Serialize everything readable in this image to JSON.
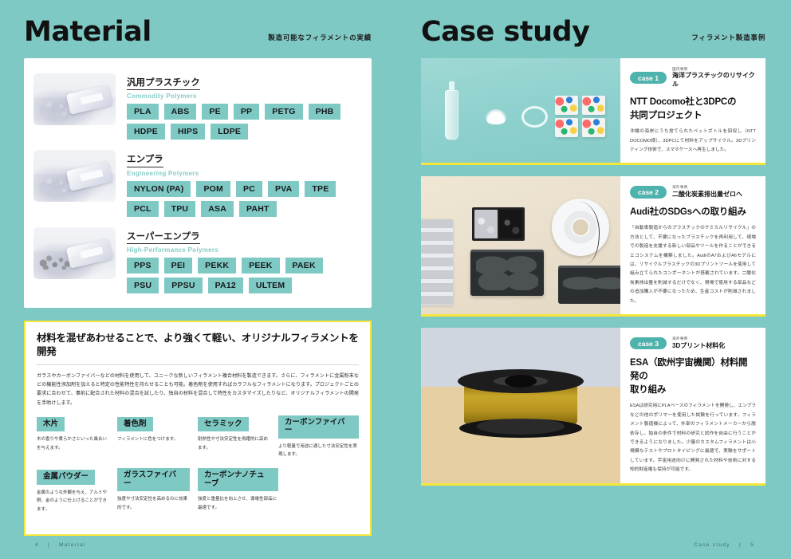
{
  "theme": {
    "background_teal": "#7fc9c4",
    "accent_yellow": "#f5e63c",
    "badge_teal": "#4fb3ad",
    "card_white": "#ffffff"
  },
  "left_page": {
    "title": "Material",
    "subtitle": "製造可能なフィラメントの実績",
    "footer": {
      "page_number": "4",
      "separator": "|",
      "section": "Material"
    },
    "material_groups": [
      {
        "name_ja": "汎用プラスチック",
        "name_en": "Commodity Polymers",
        "photo_alt": "plastic-pellets-bag-1",
        "chips": [
          "PLA",
          "ABS",
          "PE",
          "PP",
          "PETG",
          "PHB",
          "HDPE",
          "HIPS",
          "LDPE"
        ]
      },
      {
        "name_ja": "エンプラ",
        "name_en": "Engineering Polymers",
        "photo_alt": "plastic-pellets-bag-2",
        "chips": [
          "NYLON (PA)",
          "POM",
          "PC",
          "PVA",
          "TPE",
          "PCL",
          "TPU",
          "ASA",
          "PAHT"
        ]
      },
      {
        "name_ja": "スーパーエンプラ",
        "name_en": "High-Performance Polymers",
        "photo_alt": "plastic-pellets-bag-3",
        "chips": [
          "PPS",
          "PEI",
          "PEKK",
          "PEEK",
          "PAEK",
          "PSU",
          "PPSU",
          "PA12",
          "ULTEM"
        ]
      }
    ],
    "mix_section": {
      "title": "材料を混ぜあわせることで、より強くて軽い、オリジナルフィラメントを開発",
      "body": "ガラスやカーボンファイバーなどの材料を使用して、ユニークな新しいフィラメント複合材料を製造できます。さらに、フィラメントに金属粉末などの機能性添加剤を加えると特定の性能特性を持たせることも可能。着色剤を使用すればカラフルなフィラメントになります。プロジェクトごとの要求に合わせて、事前に配合された材料の混合を試したり、独自の材料を混合して特性をカスタマイズしたりなど、オリジナルフィラメントの開発を手助けします。",
      "additives": [
        {
          "tag": "木片",
          "desc": "木の香りや柔らかさといった風合いを与えます。"
        },
        {
          "tag": "着色剤",
          "desc": "フィラメントに色をつけます。"
        },
        {
          "tag": "セラミック",
          "desc": "耐熱性や寸法安定性を飛躍的に高めます。"
        },
        {
          "tag": "カーボンファイバー",
          "desc": "より軽量で用途に適した寸法安定性を実現します。"
        },
        {
          "tag": "金属パウダー",
          "desc": "金属のような外観を与え、アルミや銅、金のように仕上げることができます。"
        },
        {
          "tag": "ガラスファイバー",
          "desc": "強度や寸法安定性を高めるのに効果的です。"
        },
        {
          "tag": "カーボンナノチューブ",
          "desc": "強度と重量比を向上させ、導電性部品に最適です。"
        }
      ]
    }
  },
  "right_page": {
    "title": "Case study",
    "subtitle": "フィラメント製造事例",
    "footer": {
      "section": "Case study",
      "separator": "|",
      "page_number": "5"
    },
    "cases": [
      {
        "badge": "case 1",
        "region": "国内事例",
        "topic": "海洋プラスチックのリサイクル",
        "title": "NTT Docomo社と3DPCの\n共同プロジェクト",
        "body": "沖縄の海岸にうち捨てられたペットボトルを回収し（NTT DOCOMO様）、3DPCにて材料をアップサイクル。3Dプリンティング技術で、スマホケースへ再生しました。",
        "photo_alt": "recycled-ocean-plastic-bottle-powder-ring-letters"
      },
      {
        "badge": "case 2",
        "region": "海外事例",
        "topic": "二酸化炭素排出量ゼロへ",
        "title": "Audi社のSDGsへの取り組み",
        "body": "「自動車製造からのプラスチックのケミカルリサイクル」の方法として、不要になったプラスチックを再利用して、現場での製造を支援する新しい部品やツールを作ることができるエコシステムを構築しました。AudiのA7およびA6モデルには、リサイクルプラスチックの3Dプリントツールを使用して組み立てられたコンポーネントが搭載されています。二酸化炭素排出量を削減するだけでなく、現場で使用する部品などの追加購入が不要になったため、生産コストが削減されました。",
        "photo_alt": "workbench-with-pellet-trays-and-filament-spool"
      },
      {
        "badge": "case 3",
        "region": "海外事例",
        "topic": "3Dプリント材料化",
        "title": "ESA（欧州宇宙機関）材料開発の\n取り組み",
        "body": "ESAは研究用にPLAベースのフィラメントを開発し、エンプラなどの他のポリマーを使用した試験を行っています。フィラメント製造機によって、外部のフィラメントメーカーから脱依存し、独自の条件で材料の研究と試作を自由に行うことができるようになりました。少量のカスタムフィラメントは小規模なテストやプロトタイピングに最適で、実験をサポートしています。宇宙用途向けに開発された材料や技術に対する知的財産権も保持が可能です。",
        "photo_alt": "gold-filament-spool-on-wooden-table"
      }
    ]
  }
}
